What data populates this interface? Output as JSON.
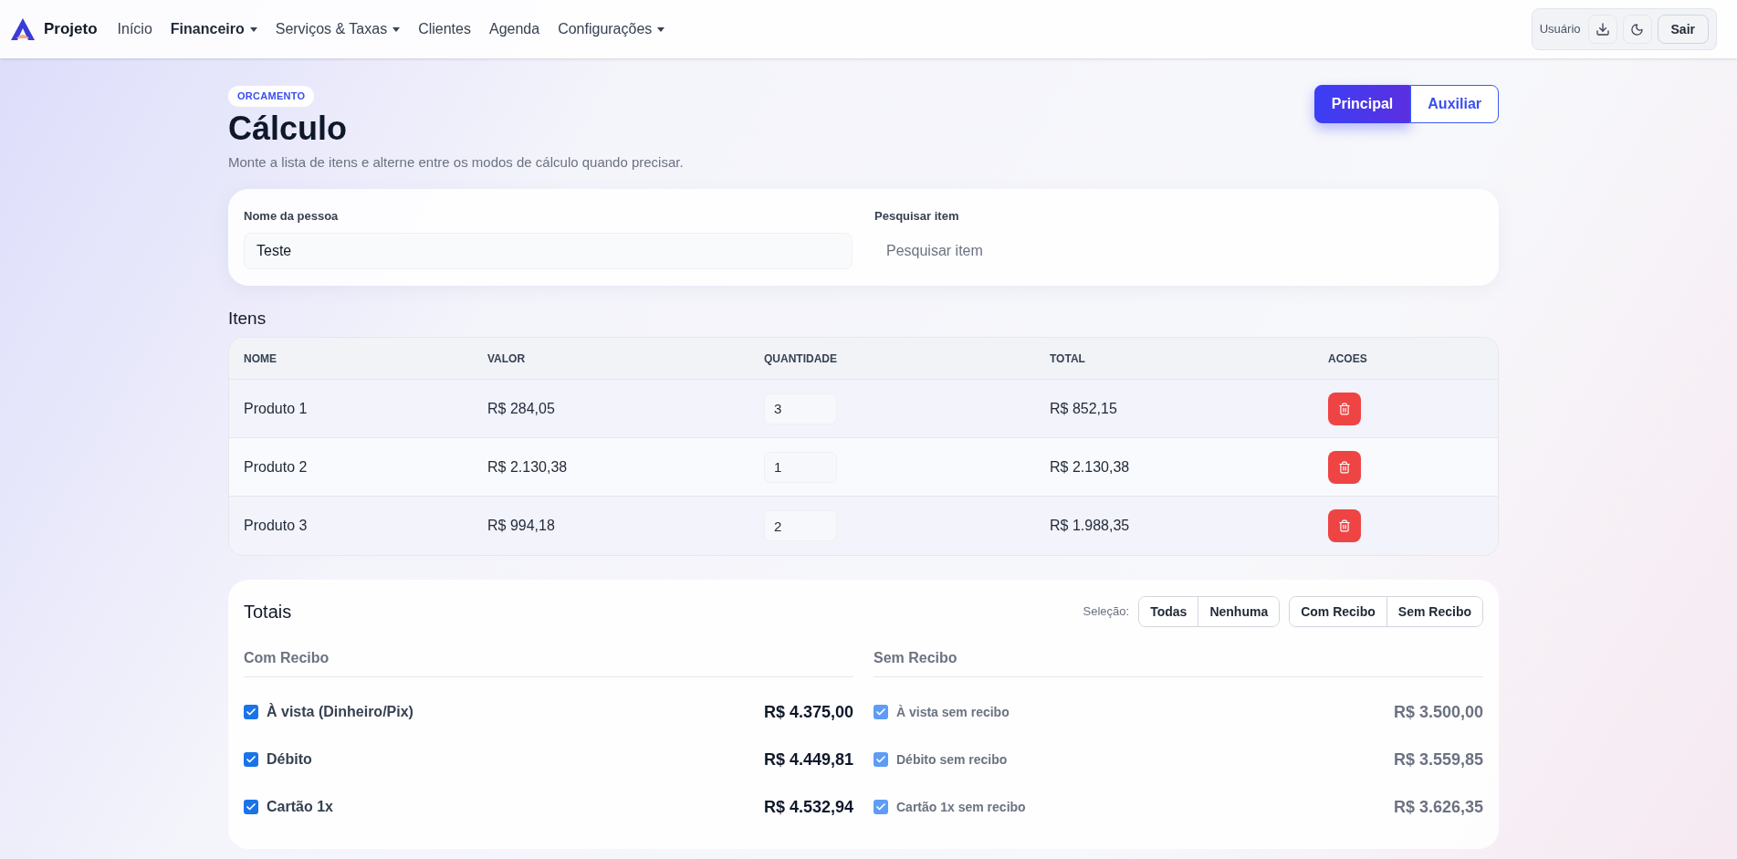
{
  "nav": {
    "brand": "Projeto",
    "items": [
      {
        "label": "Início",
        "dropdown": false,
        "selected": false
      },
      {
        "label": "Financeiro",
        "dropdown": true,
        "selected": true
      },
      {
        "label": "Serviços & Taxas",
        "dropdown": true,
        "selected": false
      },
      {
        "label": "Clientes",
        "dropdown": false,
        "selected": false
      },
      {
        "label": "Agenda",
        "dropdown": false,
        "selected": false
      },
      {
        "label": "Configurações",
        "dropdown": true,
        "selected": false
      }
    ],
    "user": "Usuário",
    "logout": "Sair"
  },
  "header": {
    "badge": "ORCAMENTO",
    "title": "Cálculo",
    "subtitle": "Monte a lista de itens e alterne entre os modos de cálculo quando precisar.",
    "modes": [
      {
        "label": "Principal",
        "selected": true
      },
      {
        "label": "Auxiliar",
        "selected": false
      }
    ]
  },
  "form": {
    "fields": [
      {
        "label": "Nome da pessoa",
        "value": "Teste"
      },
      {
        "label": "Pesquisar item",
        "placeholder": "Pesquisar item"
      }
    ]
  },
  "items": {
    "title": "Itens",
    "columns": [
      "NOME",
      "VALOR",
      "QUANTIDADE",
      "TOTAL",
      "ACOES"
    ],
    "rows": [
      {
        "name": "Produto 1",
        "value": "R$ 284,05",
        "quantity": "3",
        "total": "R$ 852,15"
      },
      {
        "name": "Produto 2",
        "value": "R$ 2.130,38",
        "quantity": "1",
        "total": "R$ 2.130,38"
      },
      {
        "name": "Produto 3",
        "value": "R$ 994,18",
        "quantity": "2",
        "total": "R$ 1.988,35"
      }
    ]
  },
  "totals": {
    "title": "Totais",
    "selection_label": "Seleção:",
    "selection_buttons": [
      "Todas",
      "Nenhuma"
    ],
    "mode_buttons": [
      "Com Recibo",
      "Sem Recibo"
    ],
    "sections": [
      {
        "title": "Com Recibo",
        "muted": false,
        "rows": [
          {
            "label": "À vista (Dinheiro/Pix)",
            "amount": "R$ 4.375,00",
            "checked": true
          },
          {
            "label": "Débito",
            "amount": "R$ 4.449,81",
            "checked": true
          },
          {
            "label": "Cartão 1x",
            "amount": "R$ 4.532,94",
            "checked": true
          }
        ]
      },
      {
        "title": "Sem Recibo",
        "muted": true,
        "rows": [
          {
            "label": "À vista sem recibo",
            "amount": "R$ 3.500,00",
            "checked": true
          },
          {
            "label": "Débito sem recibo",
            "amount": "R$ 3.559,85",
            "checked": true
          },
          {
            "label": "Cartão 1x sem recibo",
            "amount": "R$ 3.626,35",
            "checked": true
          }
        ]
      }
    ]
  }
}
